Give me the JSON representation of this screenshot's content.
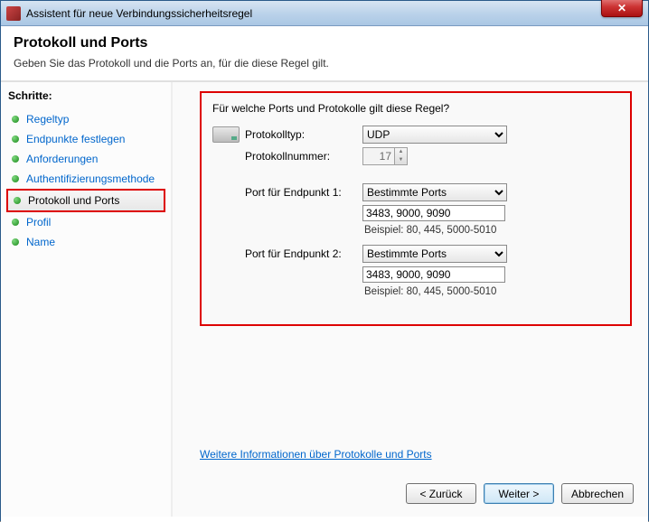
{
  "window": {
    "title": "Assistent für neue Verbindungssicherheitsregel"
  },
  "header": {
    "title": "Protokoll und Ports",
    "subtitle": "Geben Sie das Protokoll und die Ports an, für die diese Regel gilt."
  },
  "sidebar": {
    "steps_label": "Schritte:",
    "items": [
      {
        "label": "Regeltyp"
      },
      {
        "label": "Endpunkte festlegen"
      },
      {
        "label": "Anforderungen"
      },
      {
        "label": "Authentifizierungsmethode"
      },
      {
        "label": "Protokoll und Ports"
      },
      {
        "label": "Profil"
      },
      {
        "label": "Name"
      }
    ],
    "selected_index": 4
  },
  "main": {
    "question": "Für welche Ports und Protokolle gilt diese Regel?",
    "protocol_type_label": "Protokolltyp:",
    "protocol_type_value": "UDP",
    "protocol_number_label": "Protokollnummer:",
    "protocol_number_value": "17",
    "endpoint1_label": "Port für Endpunkt 1:",
    "endpoint1_select": "Bestimmte Ports",
    "endpoint1_value": "3483, 9000, 9090",
    "endpoint1_example": "Beispiel: 80, 445, 5000-5010",
    "endpoint2_label": "Port für Endpunkt 2:",
    "endpoint2_select": "Bestimmte Ports",
    "endpoint2_value": "3483, 9000, 9090",
    "endpoint2_example": "Beispiel: 80, 445, 5000-5010",
    "link": "Weitere Informationen über Protokolle und Ports"
  },
  "buttons": {
    "back": "< Zurück",
    "next": "Weiter >",
    "cancel": "Abbrechen"
  }
}
